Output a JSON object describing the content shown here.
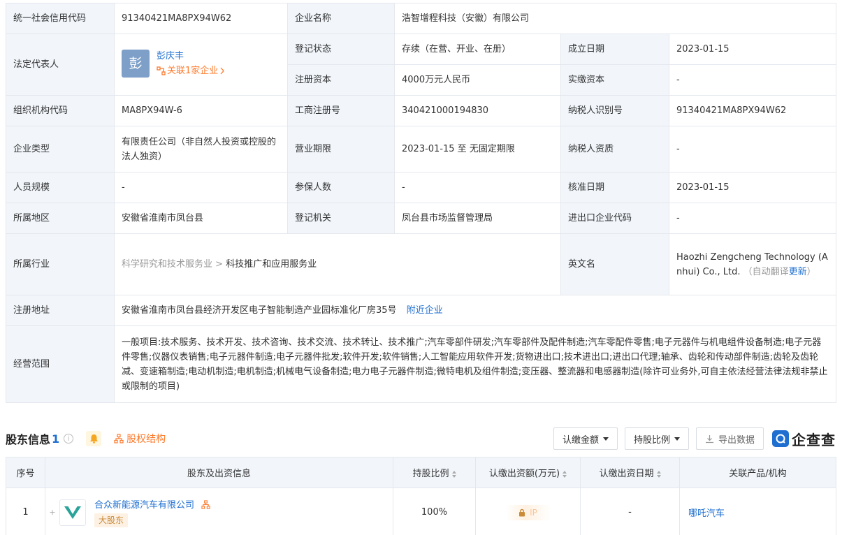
{
  "info": {
    "credit_code_label": "统一社会信用代码",
    "credit_code": "91340421MA8PX94W62",
    "company_name_label": "企业名称",
    "company_name": "浩智增程科技（安徽）有限公司",
    "legal_rep_label": "法定代表人",
    "legal_rep_avatar": "彭",
    "legal_rep_name": "彭庆丰",
    "legal_rep_related": "关联1家企业",
    "reg_status_label": "登记状态",
    "reg_status": "存续（在营、开业、在册）",
    "founded_label": "成立日期",
    "founded": "2023-01-15",
    "reg_capital_label": "注册资本",
    "reg_capital": "4000万元人民币",
    "paid_capital_label": "实缴资本",
    "paid_capital": "-",
    "org_code_label": "组织机构代码",
    "org_code": "MA8PX94W-6",
    "biz_reg_no_label": "工商注册号",
    "biz_reg_no": "340421000194830",
    "taxpayer_id_label": "纳税人识别号",
    "taxpayer_id": "91340421MA8PX94W62",
    "company_type_label": "企业类型",
    "company_type": "有限责任公司（非自然人投资或控股的法人独资）",
    "biz_term_label": "营业期限",
    "biz_term": "2023-01-15 至 无固定期限",
    "taxpayer_qual_label": "纳税人资质",
    "taxpayer_qual": "-",
    "staff_size_label": "人员规模",
    "staff_size": "-",
    "insured_label": "参保人数",
    "insured": "-",
    "approved_label": "核准日期",
    "approved": "2023-01-15",
    "region_label": "所属地区",
    "region": "安徽省淮南市凤台县",
    "authority_label": "登记机关",
    "authority": "凤台县市场监督管理局",
    "import_export_label": "进出口企业代码",
    "import_export": "-",
    "industry_label": "所属行业",
    "industry_parent": "科学研究和技术服务业",
    "industry_sep": ">",
    "industry_child": "科技推广和应用服务业",
    "english_name_label": "英文名",
    "english_name": "Haozhi Zengcheng Technology (Anhui) Co., Ltd.",
    "auto_translate": "（自动翻译",
    "update_link": "更新",
    "auto_translate_close": "）",
    "address_label": "注册地址",
    "address": "安徽省淮南市凤台县经济开发区电子智能制造产业园标准化厂房35号",
    "nearby_link": "附近企业",
    "scope_label": "经营范围",
    "scope": "一般项目:技术服务、技术开发、技术咨询、技术交流、技术转让、技术推广;汽车零部件研发;汽车零部件及配件制造;汽车零配件零售;电子元器件与机电组件设备制造;电子元器件零售;仪器仪表销售;电子元器件制造;电子元器件批发;软件开发;软件销售;人工智能应用软件开发;货物进出口;技术进出口;进出口代理;轴承、齿轮和传动部件制造;齿轮及齿轮减、变速箱制造;电动机制造;电机制造;机械电气设备制造;电力电子元器件制造;微特电机及组件制造;变压器、整流器和电感器制造(除许可业务外,可自主依法经营法律法规非禁止或限制的项目)"
  },
  "shareholders": {
    "title": "股东信息",
    "count": "1",
    "help": "i",
    "equity_structure": "股权结构",
    "btn_amount": "认缴金额",
    "btn_ratio": "持股比例",
    "btn_export": "导出数据",
    "brand": "企查查",
    "columns": {
      "index": "序号",
      "holder": "股东及出资信息",
      "ratio": "持股比例",
      "amount": "认缴出资额(万元)",
      "date": "认缴出资日期",
      "related": "关联产品/机构"
    },
    "rows": [
      {
        "index": "1",
        "expand": "+",
        "name": "合众新能源汽车有限公司",
        "badge": "大股东",
        "ratio": "100%",
        "amount_locked": "lock-icon",
        "amount_blur": "IP",
        "date": "-",
        "related": "哪吒汽车"
      }
    ]
  },
  "colors": {
    "link": "#1e6fd0",
    "accent_orange": "#ff7a2b",
    "label_bg": "#f2f6fb",
    "border": "#e4e8ee"
  }
}
